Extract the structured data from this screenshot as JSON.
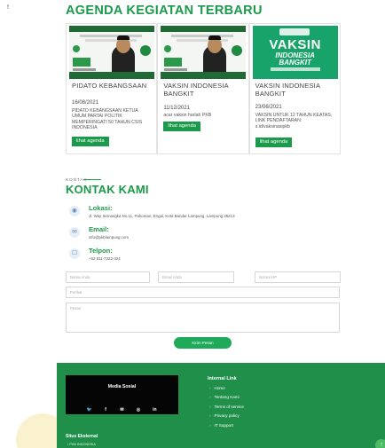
{
  "stray_mark": "!",
  "agenda": {
    "title": "AGENDA KEGIATAN TERBARU",
    "cards": [
      {
        "title": "PIDATO KEBANGSAAN",
        "date": "16/08/2021",
        "desc": "PIDATO KEBANGSAAN KETUA UMUM PARTAI POLITIK MEMPERINGATI 50 TAHUN CSIS INDONESIA",
        "button": "lihat agenda"
      },
      {
        "title": "VAKSIN INDONESIA BANGKIT",
        "date": "11/12/2021",
        "desc": "acar vaksin harlah PKB",
        "button": "lihat agenda"
      },
      {
        "title": "VAKSIN INDONESIA BANGKIT",
        "date": "23/06/2021",
        "desc": "VAKSIN UNTUK 12 TAHUN KEATAS, LINK PENDAFTARAN: s.id/vaksinasipkb",
        "button": "lihat agenda",
        "poster": {
          "big": "VAKSIN",
          "sub1": "INDONESIA",
          "sub2": "BANGKIT"
        }
      }
    ]
  },
  "contact": {
    "kicker": "KONTAK",
    "title": "KONTAK KAMI",
    "items": [
      {
        "icon": "location-icon",
        "label": "Lokasi:",
        "value": "Jl. Way Semangka No.11, Pahoman, Engal, Kota Bandar Lampung, Lampung 35213"
      },
      {
        "icon": "email-icon",
        "label": "Email:",
        "value": "info@pkblampung.com"
      },
      {
        "icon": "phone-icon",
        "label": "Telpon:",
        "value": "+62 811-7222-324"
      }
    ]
  },
  "form": {
    "name_placeholder": "Nama Anda",
    "email_placeholder": "Email Anda",
    "phone_placeholder": "Nomor HP",
    "subject_placeholder": "Perihal",
    "message_placeholder": "Pesan",
    "submit": "Kirim Pesan"
  },
  "footer": {
    "social_title": "Media Sosial",
    "social_icons": [
      "twitter-icon",
      "facebook-icon",
      "email-icon",
      "instagram-icon",
      "linkedin-icon"
    ],
    "social_glyphs": [
      "🐦",
      "f",
      "✉",
      "◎",
      "in"
    ],
    "links_title": "Internal Link",
    "links": [
      "Home",
      "Tentang Kami",
      "Terms of service",
      "Privacy policy",
      "IT Support"
    ],
    "external_title": "Situs Eksternal",
    "external_items": [
      "PKB INDONESIA"
    ]
  },
  "colors": {
    "brand_green": "#1a9a4a",
    "footer_green": "#1f8f49"
  }
}
